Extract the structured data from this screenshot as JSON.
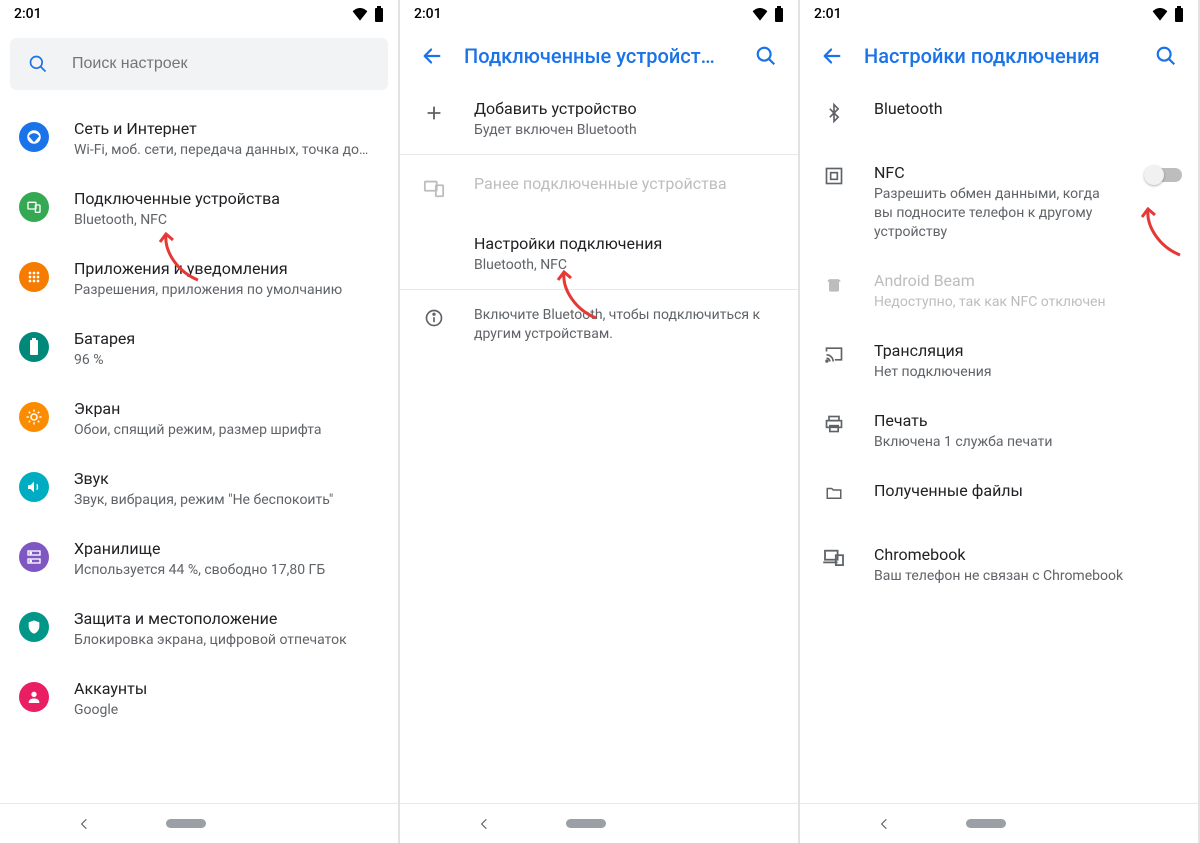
{
  "status": {
    "time": "2:01"
  },
  "pane1": {
    "search_placeholder": "Поиск настроек",
    "items": [
      {
        "title": "Сеть и Интернет",
        "subtitle": "Wi-Fi, моб. сети, передача данных, точка до…"
      },
      {
        "title": "Подключенные устройства",
        "subtitle": "Bluetooth, NFC"
      },
      {
        "title": "Приложения и уведомления",
        "subtitle": "Разрешения, приложения по умолчанию"
      },
      {
        "title": "Батарея",
        "subtitle": "96 %"
      },
      {
        "title": "Экран",
        "subtitle": "Обои, спящий режим, размер шрифта"
      },
      {
        "title": "Звук",
        "subtitle": "Звук, вибрация, режим \"Не беспокоить\""
      },
      {
        "title": "Хранилище",
        "subtitle": "Используется 44 %, свободно 17,80 ГБ"
      },
      {
        "title": "Защита и местоположение",
        "subtitle": "Блокировка экрана, цифровой отпечаток"
      },
      {
        "title": "Аккаунты",
        "subtitle": "Google"
      }
    ]
  },
  "pane2": {
    "title": "Подключенные устройст…",
    "pair": {
      "title": "Добавить устройство",
      "subtitle": "Будет включен Bluetooth"
    },
    "category": "Ранее подключенные устройства",
    "prefs": {
      "title": "Настройки подключения",
      "subtitle": "Bluetooth, NFC"
    },
    "info": "Включите Bluetooth, чтобы подключиться к другим устройствам."
  },
  "pane3": {
    "title": "Настройки подключения",
    "items": {
      "bluetooth": {
        "title": "Bluetooth"
      },
      "nfc": {
        "title": "NFC",
        "subtitle": "Разрешить обмен данными, когда вы подносите телефон к другому устройству"
      },
      "beam": {
        "title": "Android Beam",
        "subtitle": "Недоступно, так как NFC отключен"
      },
      "cast": {
        "title": "Трансляция",
        "subtitle": "Нет подключения"
      },
      "print": {
        "title": "Печать",
        "subtitle": "Включена 1 служба печати"
      },
      "files": {
        "title": "Полученные файлы"
      },
      "chromebook": {
        "title": "Chromebook",
        "subtitle": "Ваш телефон не связан с Chromebook"
      }
    }
  }
}
